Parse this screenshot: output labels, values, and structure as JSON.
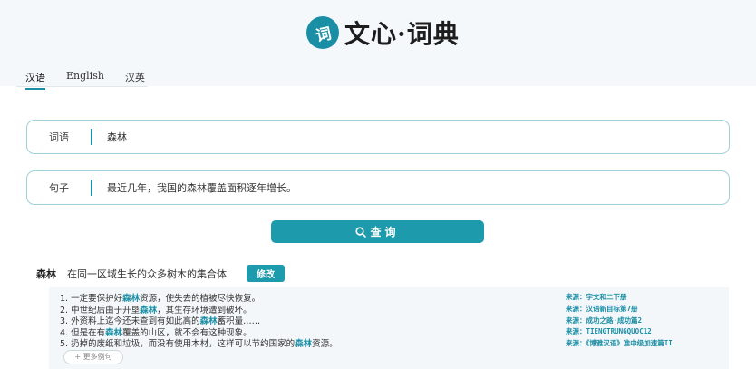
{
  "logo": {
    "glyph": "词",
    "title": "文心·词典"
  },
  "tabs": [
    {
      "label": "汉语",
      "active": true
    },
    {
      "label": "English",
      "active": false
    },
    {
      "label": "汉英",
      "active": false
    }
  ],
  "fields": {
    "word": {
      "label": "词语",
      "value": "森林"
    },
    "sentence": {
      "label": "句子",
      "value": "最近几年，我国的森林覆盖面积逐年增长。"
    }
  },
  "query_button": {
    "label": "查询"
  },
  "result": {
    "word": "森林",
    "definition": "在同一区域生长的众多树木的集合体",
    "edit_label": "修改"
  },
  "examples": [
    {
      "num": "1.",
      "before": "一定要保护好",
      "hl": "森林",
      "after": "资源，使失去的植被尽快恢复。"
    },
    {
      "num": "2.",
      "before": "中世纪后由于开垦",
      "hl": "森林",
      "after": "，其生存环境遭到破坏。"
    },
    {
      "num": "3.",
      "before": "外资料上迄今还未查到有如此高的",
      "hl": "森林",
      "after": "蓄积量……"
    },
    {
      "num": "4.",
      "before": "但是在有",
      "hl": "森林",
      "after": "覆盖的山区，就不会有这种现象。"
    },
    {
      "num": "5.",
      "before": "扔掉的废纸和垃圾，而没有使用木材，这样可以节约国家的",
      "hl": "森林",
      "after": "资源。"
    }
  ],
  "sources": [
    "来源：字文和二下册",
    "来源：汉语新目标第7册",
    "来源：成功之路·成功篇2",
    "来源：TIENGTRUNGQUOC12",
    "来源：《博雅汉语》准中级加速篇II"
  ],
  "more_label": "+ 更多例句",
  "colors": {
    "accent": "#1d9bad",
    "field_border": "#9fd0d9",
    "examples_bg": "#f3f7f9"
  }
}
